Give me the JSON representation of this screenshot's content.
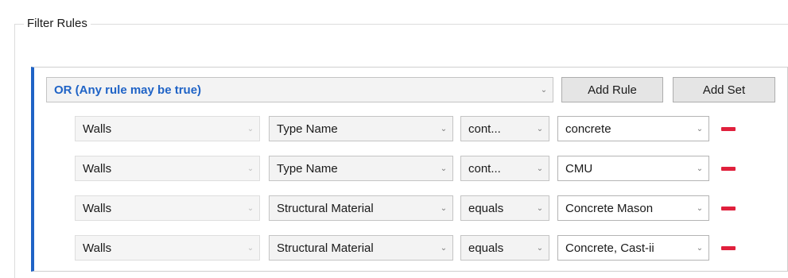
{
  "group": {
    "title": "Filter Rules"
  },
  "set": {
    "logic_label": "OR (Any rule may be true)",
    "add_rule_label": "Add Rule",
    "add_set_label": "Add Set"
  },
  "rules": [
    {
      "category": "Walls",
      "parameter": "Type Name",
      "operator": "cont...",
      "value": "concrete"
    },
    {
      "category": "Walls",
      "parameter": "Type Name",
      "operator": "cont...",
      "value": "CMU"
    },
    {
      "category": "Walls",
      "parameter": "Structural Material",
      "operator": "equals",
      "value": "Concrete Mason"
    },
    {
      "category": "Walls",
      "parameter": "Structural Material",
      "operator": "equals",
      "value": "Concrete, Cast-ii"
    }
  ],
  "icons": {
    "dropdown": "chevron-down-icon",
    "remove": "minus-icon"
  },
  "colors": {
    "accent": "#1f63c6",
    "remove": "#e0203c"
  }
}
